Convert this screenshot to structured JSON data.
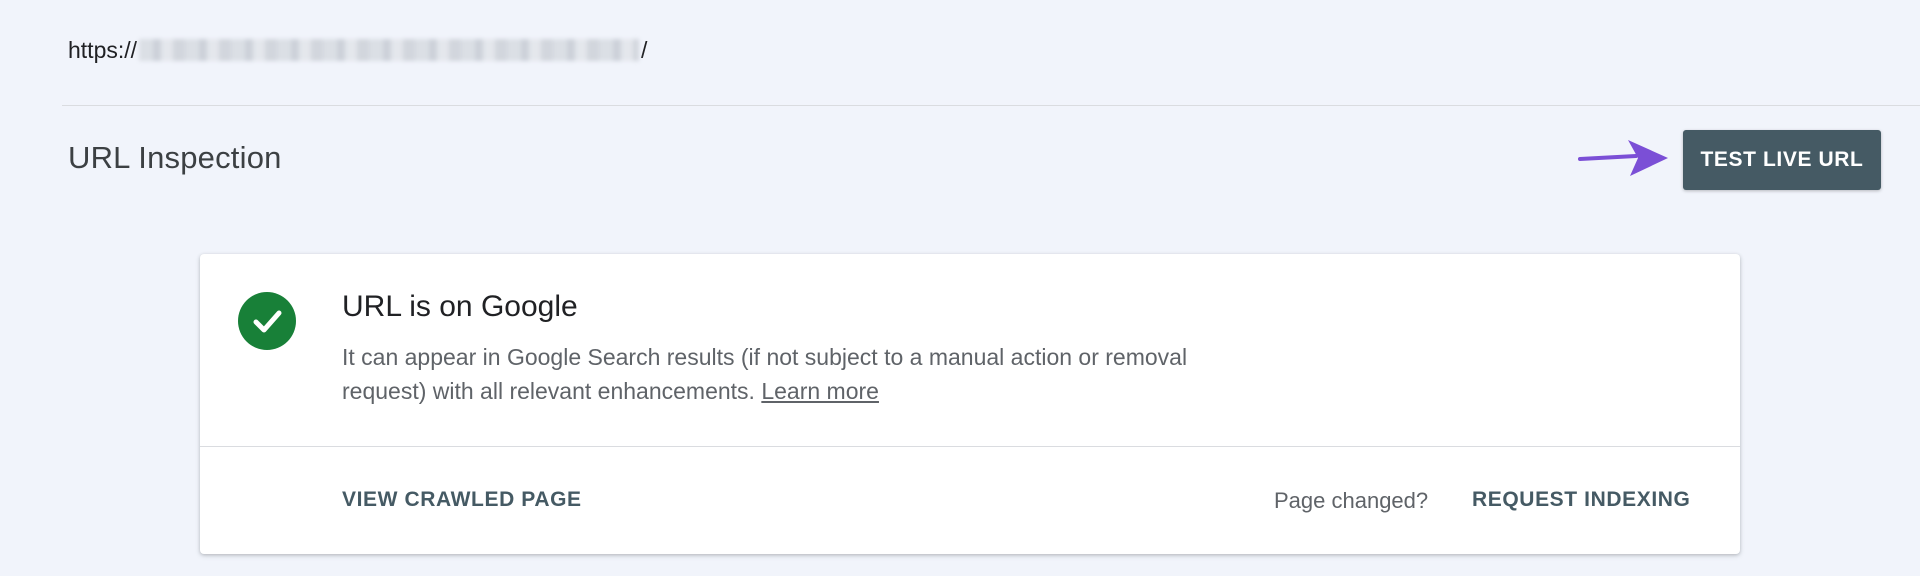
{
  "url": {
    "prefix": "https://",
    "suffix": "/"
  },
  "header": {
    "title": "URL Inspection",
    "test_live_url_label": "TEST LIVE URL"
  },
  "status_card": {
    "title": "URL is on Google",
    "description": "It can appear in Google Search results (if not subject to a manual action or removal request) with all relevant enhancements.",
    "learn_more_label": "Learn more",
    "view_crawled_label": "VIEW CRAWLED PAGE",
    "page_changed_text": "Page changed?",
    "request_indexing_label": "REQUEST INDEXING"
  },
  "colors": {
    "background": "#f1f4fb",
    "primary_button": "#455a64",
    "success": "#188038",
    "annotation_arrow": "#7b4fd6"
  }
}
